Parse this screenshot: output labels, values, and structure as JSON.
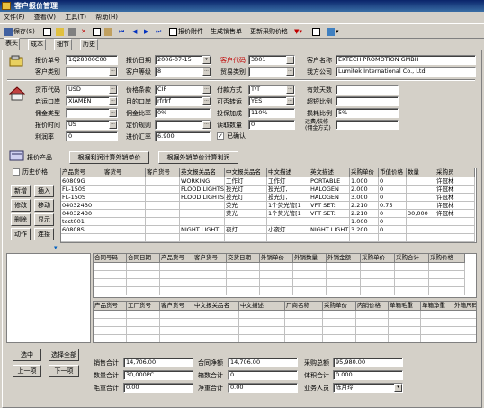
{
  "window": {
    "title": "客户报价管理"
  },
  "menu": [
    "文件(F)",
    "查看(V)",
    "工具(T)",
    "帮助(H)"
  ],
  "toolbar": {
    "save": "保存(S)",
    "price_list": "报价附件",
    "gen_order": "生成销售单",
    "update_purchase": "更新采购价格"
  },
  "tabs": [
    "表头",
    "成本",
    "细节",
    "历史"
  ],
  "header": {
    "quote_no_label": "报价单号",
    "quote_no": "1Q28000C00",
    "quote_date_label": "报价日期",
    "quote_date": "2006-07-15",
    "cust_code_label": "客户代码",
    "cust_code": "3001",
    "cust_name_label": "客户名称",
    "cust_name": "EKTECH PROMOTION GMBH",
    "cust_type_label": "客户类别",
    "cust_type": "",
    "cust_level_label": "客户等级",
    "cust_level": "8",
    "biz_type_label": "贸易类别",
    "biz_type": "",
    "our_company_label": "我方公司",
    "our_company": "Lumitek International Co., Ltd"
  },
  "terms": {
    "currency_label": "货币代码",
    "currency": "USD",
    "price_term_label": "价格条款",
    "price_term": "CIF",
    "pay_method_label": "付款方式",
    "pay_method": "T/T",
    "valid_days_label": "有效天数",
    "valid_days": "",
    "origin_port_label": "启运口岸",
    "origin_port": "XIAMEN",
    "dest_port_label": "目的口岸",
    "dest_port": "rfrfrf",
    "ship_method_label": "可否转运",
    "ship_method": "YES",
    "partial_label": "超短比例",
    "partial": "",
    "commission_label": "佣金类型",
    "commission": "",
    "profit_rate_label": "佣金比率",
    "profit_rate": "0%",
    "insurance_label": "投保加成",
    "insurance": "110%",
    "loss_rate_label": "损耗比例",
    "loss_rate": "5%",
    "quote_by_label": "报价时间",
    "quote_by": "US",
    "grade_label": "定价规则",
    "grade": "",
    "cust_qty_label": "读取数量",
    "cust_qty": "0",
    "special_label": "运费/装修(佣金方式)",
    "special": "",
    "rate_label": "利润率",
    "rate": "0",
    "exchange_label": "进价汇率",
    "exchange": "6.900",
    "confirmed_label": "已确认"
  },
  "products_section": {
    "title": "报价产品",
    "history_price": "历史价格",
    "recalc_cost": "根据利润计算外销单价",
    "recalc_profit": "根据外销单价计算利润",
    "buttons": [
      "新增",
      "插入",
      "修改",
      "移动",
      "删除",
      "显示",
      "动作",
      "连接"
    ]
  },
  "product_grid": {
    "columns": [
      "产品货号",
      "客货号",
      "客户货号",
      "英文报关品名",
      "中文报关品名",
      "中文描述",
      "英文描述",
      "采购单价",
      "币值价格",
      "数量",
      "采购员"
    ],
    "rows": [
      [
        "60809G",
        "",
        "",
        "WORKING",
        "工作灯",
        "工作灯",
        "PORTABLE",
        "1.000",
        "0",
        "",
        "许冠林"
      ],
      [
        "FL-150S",
        "",
        "",
        "FLOOD LIGHTS",
        "投光灯",
        "投光灯,",
        "HALOGEN",
        "2.000",
        "0",
        "",
        "许冠林"
      ],
      [
        "FL-150S",
        "",
        "",
        "FLOOD LIGHTS",
        "投光灯",
        "投光灯,",
        "HALOGEN",
        "3.000",
        "0",
        "",
        "许冠林"
      ],
      [
        "04032430",
        "",
        "",
        "",
        "荧光",
        "1个荧光管[1",
        "VFT SET:",
        "2.210",
        "0.75",
        "",
        "许冠林"
      ],
      [
        "04032430",
        "",
        "",
        "",
        "荧光",
        "1个荧光管[1",
        "VFT SET:",
        "2.210",
        "0",
        "30,000",
        "许冠林"
      ],
      [
        "test001",
        "",
        "",
        "",
        "",
        "",
        "",
        "1.000",
        "0",
        "",
        ""
      ],
      [
        "60808S",
        "",
        "",
        "NIGHT LIGHT",
        "夜灯",
        "小夜灯",
        "NIGHT LIGHT",
        "3.200",
        "0",
        "",
        ""
      ]
    ]
  },
  "detail_grid1": {
    "columns": [
      "合同号码",
      "合同日期",
      "产品货号",
      "客户货号",
      "交货日期",
      "外销单价",
      "外销数量",
      "外销金额",
      "采购单价",
      "采购合计",
      "采购价格"
    ]
  },
  "detail_grid2": {
    "columns": [
      "产品货号",
      "工厂货号",
      "客户货号",
      "中文报关品名",
      "中文描述",
      "厂商名称",
      "采购单价",
      "内销价格",
      "单箱毛重",
      "单箱净重",
      "外箱尺码"
    ]
  },
  "nav": {
    "select": "选中",
    "select_all": "选择全部",
    "prev": "上一项",
    "next": "下一项"
  },
  "totals": {
    "sales_total_label": "销售合计",
    "sales_total": "14,706.00",
    "contract_total_label": "合同净额",
    "contract_total": "14,706.00",
    "purchase_total_label": "采购总额",
    "purchase_total": "95,980.00",
    "qty_total_label": "数量合计",
    "qty_total": "30,000PC",
    "box_total_label": "箱数合计",
    "box_total": "0",
    "gross_total_label": "体积合计",
    "gross_total": "0.000",
    "weight_total_label": "毛重合计",
    "weight_total": "0.00",
    "net_total_label": "净重合计",
    "net_total": "0.00",
    "sales_person_label": "业务人员",
    "sales_person": "陈月玲"
  }
}
